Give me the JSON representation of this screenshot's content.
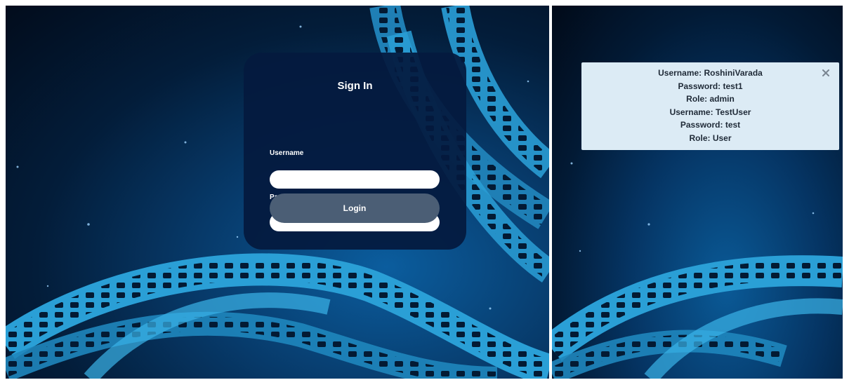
{
  "login": {
    "title": "Sign In",
    "username_label": "Username",
    "username_value": "",
    "password_label": "Password",
    "password_value": "",
    "login_button": "Login"
  },
  "credentials": {
    "lines": [
      "Username: RoshiniVarada",
      "Password: test1",
      "Role: admin",
      "Username: TestUser",
      "Password: test",
      "Role: User"
    ],
    "close_icon": "close-icon"
  },
  "colors": {
    "card_background": "#041a3e",
    "button_background": "#4b5e75",
    "info_box_background": "#dcebf5",
    "film_strip": "#2a9fd6"
  }
}
